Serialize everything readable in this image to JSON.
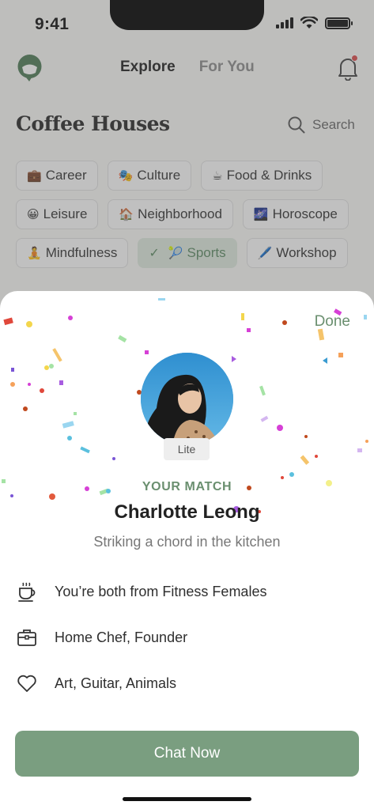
{
  "status_bar": {
    "time": "9:41"
  },
  "header": {
    "tabs": [
      {
        "label": "Explore",
        "active": true
      },
      {
        "label": "For You",
        "active": false
      }
    ],
    "notification_dot": true
  },
  "page": {
    "title": "Coffee Houses",
    "search_label": "Search"
  },
  "chips": [
    {
      "emoji": "💼",
      "label": "Career",
      "selected": false
    },
    {
      "emoji": "🎭",
      "label": "Culture",
      "selected": false
    },
    {
      "emoji": "☕",
      "label": "Food & Drinks",
      "selected": false
    },
    {
      "emoji": "😀",
      "label": "Leisure",
      "selected": false
    },
    {
      "emoji": "🏠",
      "label": "Neighborhood",
      "selected": false
    },
    {
      "emoji": "🌌",
      "label": "Horoscope",
      "selected": false
    },
    {
      "emoji": "🧘",
      "label": "Mindfulness",
      "selected": false
    },
    {
      "emoji": "🎾",
      "label": "Sports",
      "selected": true
    },
    {
      "emoji": "🖊️",
      "label": "Workshop",
      "selected": false
    }
  ],
  "sheet": {
    "done_label": "Done",
    "tier_badge": "Lite",
    "match_label": "YOUR MATCH",
    "name": "Charlotte Leong",
    "tagline": "Striking a chord in the kitchen",
    "details": [
      {
        "icon": "coffee-cup-icon",
        "text": "You’re both from Fitness Females"
      },
      {
        "icon": "briefcase-icon",
        "text": "Home Chef, Founder"
      },
      {
        "icon": "heart-icon",
        "text": "Art, Guitar, Animals"
      }
    ],
    "cta_label": "Chat Now"
  },
  "colors": {
    "accent": "#7a9e80",
    "accent_text": "#6a8f6f",
    "chip_selected_bg": "#dde8dd",
    "overlay": "rgba(90,90,90,0.36)",
    "notification": "#d94c4c"
  }
}
